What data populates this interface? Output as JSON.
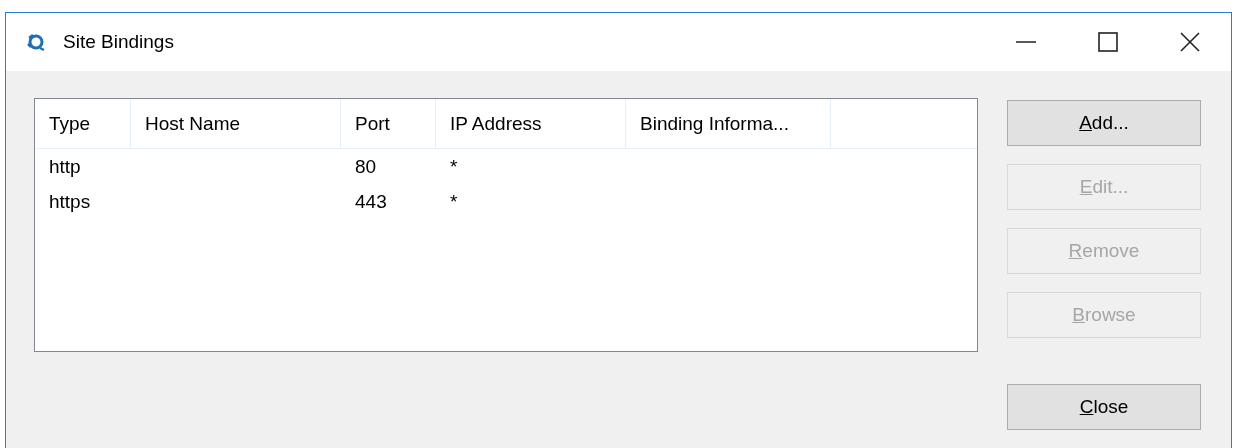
{
  "window": {
    "title": "Site Bindings"
  },
  "table": {
    "columns": [
      "Type",
      "Host Name",
      "Port",
      "IP Address",
      "Binding Informa..."
    ],
    "rows": [
      [
        "http",
        "",
        "80",
        "*",
        ""
      ],
      [
        "https",
        "",
        "443",
        "*",
        ""
      ]
    ]
  },
  "buttons": [
    {
      "key": "A",
      "rest": "dd...",
      "disabled": false
    },
    {
      "key": "E",
      "rest": "dit...",
      "disabled": true
    },
    {
      "key": "R",
      "rest": "emove",
      "disabled": true
    },
    {
      "key": "B",
      "rest": "rowse",
      "disabled": true
    },
    {
      "key": "C",
      "rest": "lose",
      "disabled": false
    }
  ]
}
